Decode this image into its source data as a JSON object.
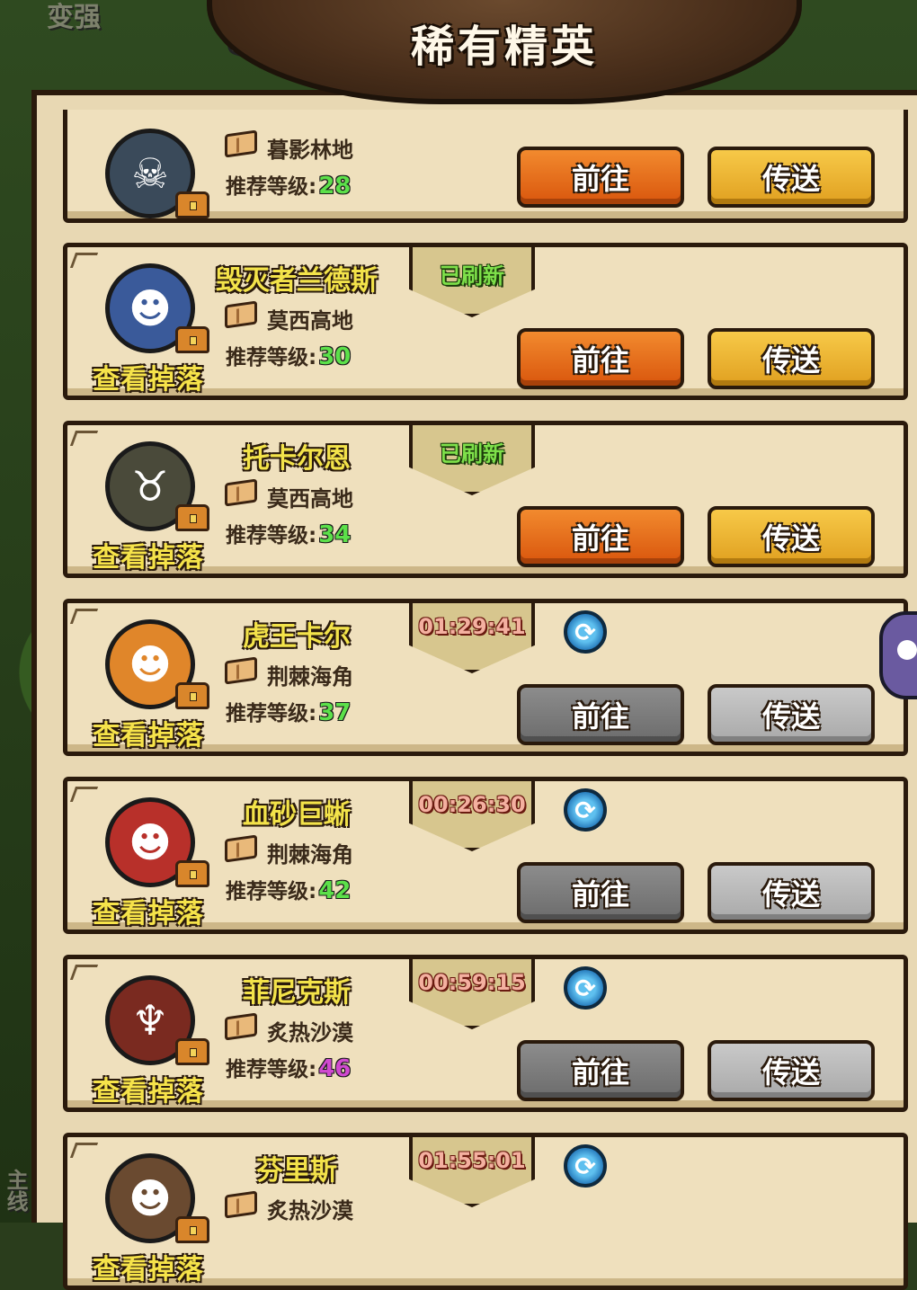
{
  "title": "稀有精英",
  "background_labels": [
    "变强",
    "主线"
  ],
  "drop_label": "查看掉落",
  "level_prefix": "推荐等级:",
  "buttons": {
    "go": "前往",
    "teleport": "传送"
  },
  "elites": [
    {
      "name": "",
      "location": "暮影林地",
      "level": "28",
      "status": "",
      "status_type": "none",
      "enabled": true,
      "avatar_icon": "skull-icon",
      "avatar_color": "#3a4a5a",
      "level_color": "#5ce04a"
    },
    {
      "name": "毁灭者兰德斯",
      "location": "莫西高地",
      "level": "30",
      "status": "已刷新",
      "status_type": "refreshed",
      "enabled": true,
      "avatar_icon": "troll-icon",
      "avatar_color": "#3a5a9a",
      "level_color": "#5ce04a"
    },
    {
      "name": "托卡尔恩",
      "location": "莫西高地",
      "level": "34",
      "status": "已刷新",
      "status_type": "refreshed",
      "enabled": true,
      "avatar_icon": "horned-beast-icon",
      "avatar_color": "#4a4a3a",
      "level_color": "#5ce04a"
    },
    {
      "name": "虎王卡尔",
      "location": "荆棘海角",
      "level": "37",
      "status": "01:29:41",
      "status_type": "timer",
      "enabled": false,
      "avatar_icon": "tiger-icon",
      "avatar_color": "#e0862a",
      "level_color": "#5ce04a"
    },
    {
      "name": "血砂巨蜥",
      "location": "荆棘海角",
      "level": "42",
      "status": "00:26:30",
      "status_type": "timer",
      "enabled": false,
      "avatar_icon": "lizard-icon",
      "avatar_color": "#b8302a",
      "level_color": "#5ce04a"
    },
    {
      "name": "菲尼克斯",
      "location": "炙热沙漠",
      "level": "46",
      "status": "00:59:15",
      "status_type": "timer",
      "enabled": false,
      "avatar_icon": "phoenix-icon",
      "avatar_color": "#7a2a20",
      "level_color": "#d04ad0"
    },
    {
      "name": "芬里斯",
      "location": "炙热沙漠",
      "level": "",
      "status": "01:55:01",
      "status_type": "timer",
      "enabled": false,
      "avatar_icon": "wolf-icon",
      "avatar_color": "#6a4a30",
      "level_color": "#d04ad0"
    }
  ]
}
